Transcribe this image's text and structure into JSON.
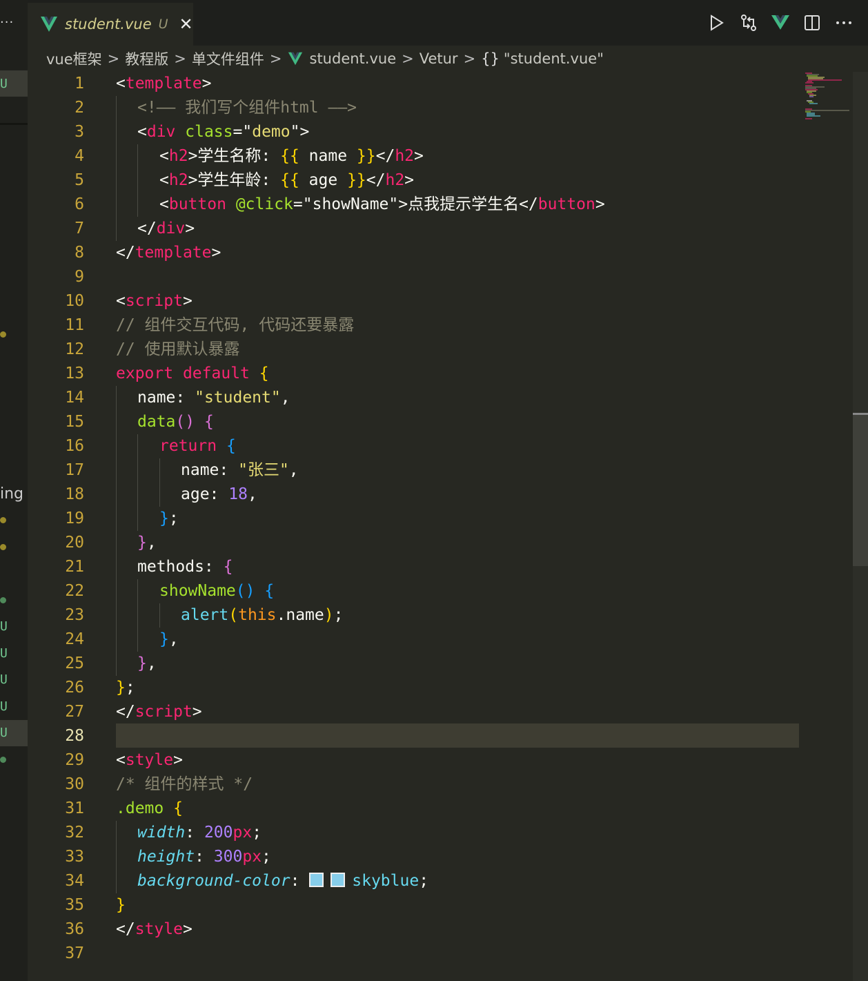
{
  "sidebar": {
    "more_label": "···",
    "partial_label": "ing",
    "u_badge": "U"
  },
  "tab": {
    "filename": "student.vue",
    "status": "U",
    "close": "✕"
  },
  "toolbar": {
    "run_icon": "play-icon",
    "compare_icon": "compare-changes-icon",
    "vue_icon": "vue-devtools-icon",
    "split_icon": "split-editor-icon",
    "more_icon": "more-actions-icon"
  },
  "breadcrumb": {
    "items": [
      "vue框架",
      "教程版",
      "单文件组件",
      "student.vue",
      "Vetur"
    ],
    "symbol_braces": "{}",
    "symbol_label": "\"student.vue\""
  },
  "editor": {
    "active_line": 28,
    "lines": [
      {
        "n": "1"
      },
      {
        "n": "2"
      },
      {
        "n": "3"
      },
      {
        "n": "4"
      },
      {
        "n": "5"
      },
      {
        "n": "6"
      },
      {
        "n": "7"
      },
      {
        "n": "8"
      },
      {
        "n": "9"
      },
      {
        "n": "10"
      },
      {
        "n": "11"
      },
      {
        "n": "12"
      },
      {
        "n": "13"
      },
      {
        "n": "14"
      },
      {
        "n": "15"
      },
      {
        "n": "16"
      },
      {
        "n": "17"
      },
      {
        "n": "18"
      },
      {
        "n": "19"
      },
      {
        "n": "20"
      },
      {
        "n": "21"
      },
      {
        "n": "22"
      },
      {
        "n": "23"
      },
      {
        "n": "24"
      },
      {
        "n": "25"
      },
      {
        "n": "26"
      },
      {
        "n": "27"
      },
      {
        "n": "28"
      },
      {
        "n": "29"
      },
      {
        "n": "30"
      },
      {
        "n": "31"
      },
      {
        "n": "32"
      },
      {
        "n": "33"
      },
      {
        "n": "34"
      },
      {
        "n": "35"
      },
      {
        "n": "36"
      },
      {
        "n": "37"
      }
    ],
    "tokens": {
      "l1": [
        "<",
        "template",
        ">"
      ],
      "l2": "<!—— 我们写个组件html ——>",
      "l3": [
        "<",
        "div",
        " ",
        "class",
        "=\"",
        "demo",
        "\">"
      ],
      "l4": [
        "<",
        "h2",
        ">学生名称: ",
        "{{",
        " name ",
        "}}",
        "</",
        "h2",
        ">"
      ],
      "l5": [
        "<",
        "h2",
        ">学生年龄: ",
        "{{",
        " age ",
        "}}",
        "</",
        "h2",
        ">"
      ],
      "l6": [
        "<",
        "button",
        " ",
        "@click",
        "=\"",
        "showName",
        "\">点我提示学生名</",
        "button",
        ">"
      ],
      "l7": [
        "</",
        "div",
        ">"
      ],
      "l8": [
        "</",
        "template",
        ">"
      ],
      "l10": [
        "<",
        "script",
        ">"
      ],
      "l11": "// 组件交互代码, 代码还要暴露",
      "l12": "// 使用默认暴露",
      "l13": [
        "export",
        " ",
        "default",
        " ",
        "{"
      ],
      "l14": [
        "name: ",
        "\"student\"",
        ","
      ],
      "l15": [
        "data",
        "()",
        " ",
        "{"
      ],
      "l16": [
        "return",
        " ",
        "{"
      ],
      "l17": [
        "name: ",
        "\"张三\"",
        ","
      ],
      "l18": [
        "age: ",
        "18",
        ","
      ],
      "l19": [
        "}",
        ";"
      ],
      "l20": [
        "}",
        ","
      ],
      "l21": [
        "methods: ",
        "{"
      ],
      "l22": [
        "showName",
        "()",
        " ",
        "{"
      ],
      "l23": [
        "alert",
        "(",
        "this",
        ".name",
        ")",
        ";"
      ],
      "l24": [
        "}",
        ","
      ],
      "l25": [
        "}",
        ","
      ],
      "l26": [
        "}",
        ";"
      ],
      "l27": [
        "</",
        "script",
        ">"
      ],
      "l29": [
        "<",
        "style",
        ">"
      ],
      "l30": "/* 组件的样式 */",
      "l31": [
        ".demo",
        " ",
        "{"
      ],
      "l32": [
        "width",
        ": ",
        "200",
        "px",
        ";"
      ],
      "l33": [
        "height",
        ": ",
        "300",
        "px",
        ";"
      ],
      "l34": [
        "background-color",
        ": ",
        "skyblue",
        ";"
      ],
      "l35": "}",
      "l36": [
        "</",
        "style",
        ">"
      ]
    }
  },
  "colors": {
    "background": "#272822",
    "tag": "#f92672",
    "string": "#e6db74",
    "function": "#a6e22e",
    "number": "#ae81ff",
    "comment": "#8a8772",
    "swatch_skyblue": "#87ceeb"
  }
}
